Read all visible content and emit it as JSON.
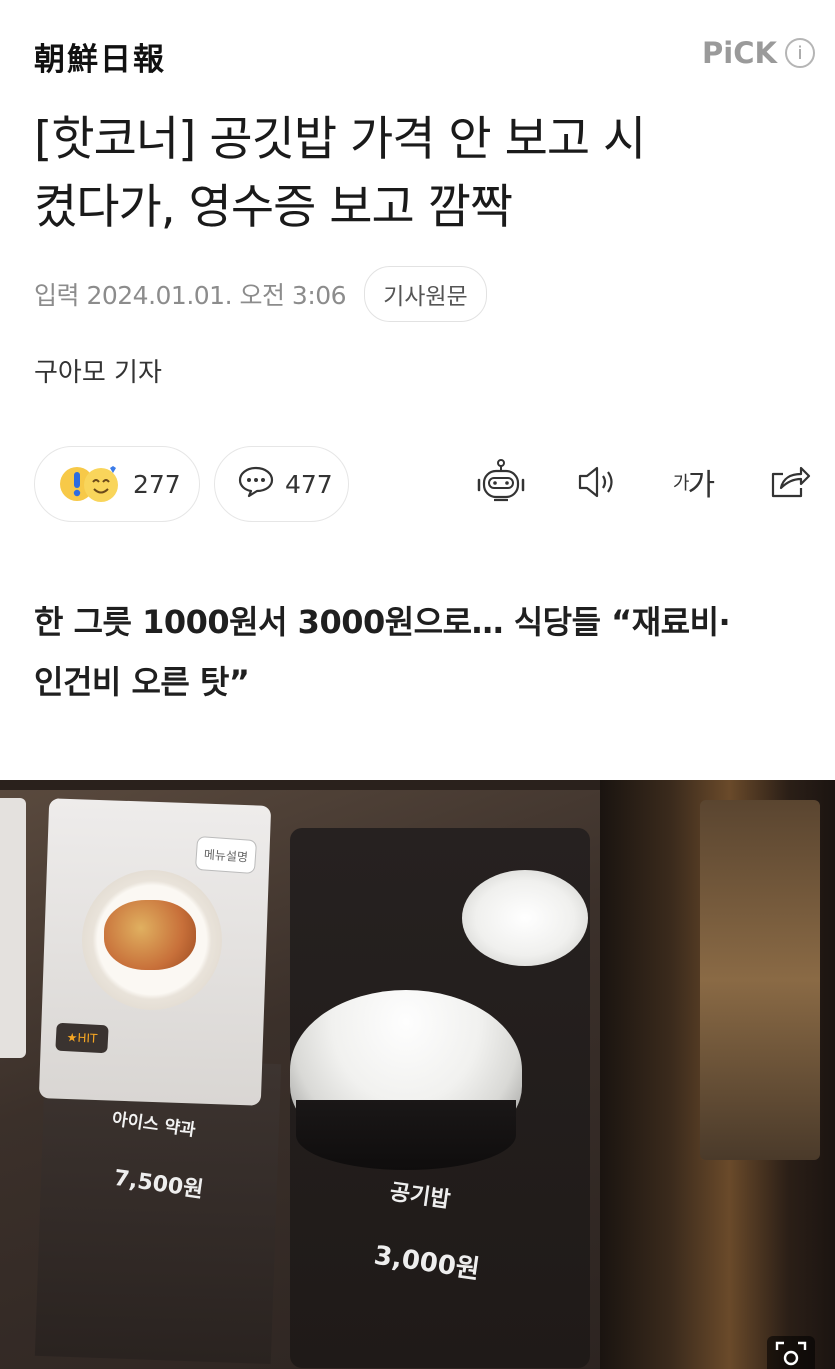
{
  "header": {
    "logo_text": "朝鮮日報",
    "pick_label": "PiCK",
    "info_symbol": "i"
  },
  "article": {
    "title_line1": "[핫코너] 공깃밥 가격 안 보고 시",
    "title_line2": "켰다가, 영수증 보고 깜짝",
    "date": "입력 2024.01.01. 오전 3:06",
    "original_button": "기사원문",
    "reporter": "구아모 기자",
    "subtitle_line1": "한 그릇 1000원서 3000원으로… 식당들 “재료비·",
    "subtitle_line2": "인건비 오른 탓”"
  },
  "actions": {
    "reaction_count": "277",
    "comment_count": "477",
    "font_small": "가",
    "font_large": "가"
  },
  "photo": {
    "menu_tag": "메뉴설명",
    "hit_tag": "★HIT",
    "item1_name": "아이스 약과",
    "item1_price": "7,500원",
    "item2_name": "공기밥",
    "item2_price": "3,000원"
  },
  "icons": {
    "reaction": "surprised-smile-emoji-icon",
    "comment": "speech-bubble-icon",
    "summary": "robot-icon",
    "tts": "speaker-icon",
    "share": "share-icon",
    "zoom": "expand-icon"
  }
}
